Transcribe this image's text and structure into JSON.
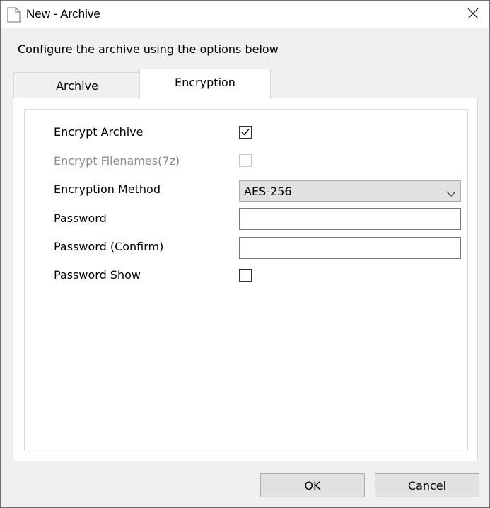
{
  "window": {
    "title": "New - Archive"
  },
  "instructions": "Configure the archive using the options below",
  "tabs": [
    {
      "label": "Archive",
      "active": false
    },
    {
      "label": "Encryption",
      "active": true
    }
  ],
  "encryption": {
    "encrypt_archive": {
      "label": "Encrypt Archive",
      "checked": true
    },
    "encrypt_filenames": {
      "label": "Encrypt Filenames(7z)",
      "checked": false,
      "enabled": false
    },
    "method": {
      "label": "Encryption Method",
      "value": "AES-256"
    },
    "password": {
      "label": "Password",
      "value": ""
    },
    "password_confirm": {
      "label": "Password (Confirm)",
      "value": ""
    },
    "password_show": {
      "label": "Password Show",
      "checked": false
    }
  },
  "buttons": {
    "ok": "OK",
    "cancel": "Cancel"
  },
  "icons": {
    "title": "document-icon",
    "close": "close-icon",
    "dropdown": "chevron-down-icon",
    "check": "checkmark-icon"
  }
}
